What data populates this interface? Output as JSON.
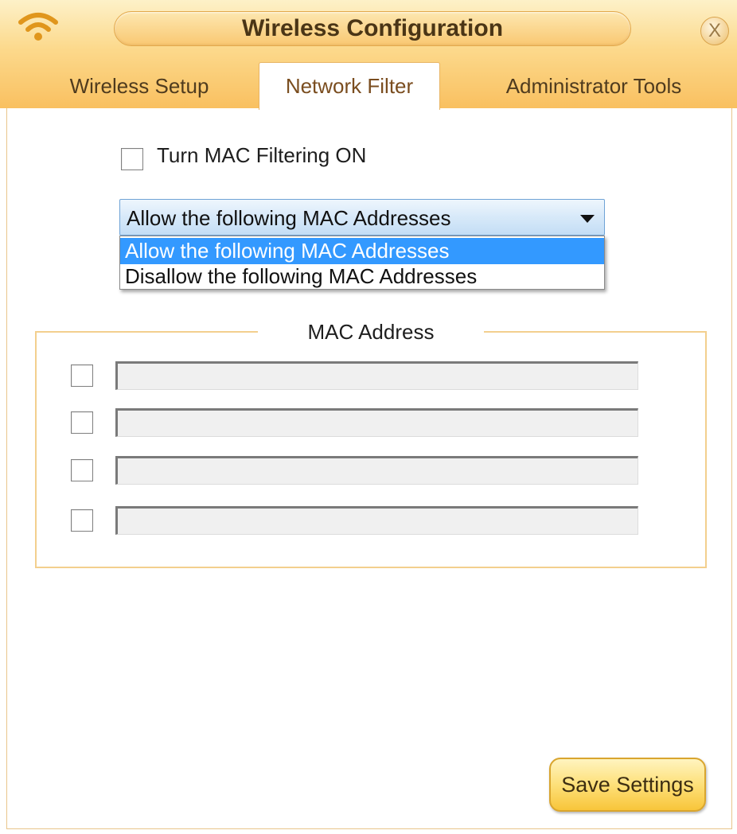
{
  "window": {
    "title": "Wireless Configuration",
    "close_glyph": "X",
    "header_icon": "wifi-icon"
  },
  "tabs": [
    {
      "label": "Wireless Setup",
      "active": false
    },
    {
      "label": "Network Filter",
      "active": true
    },
    {
      "label": "Administrator Tools",
      "active": false
    }
  ],
  "network_filter": {
    "mac_filtering_label": "Turn MAC Filtering ON",
    "mac_filtering_checked": false,
    "mode_select": {
      "selected": "Allow the following MAC Addresses",
      "expanded": true,
      "options": [
        {
          "label": "Allow the following MAC Addresses",
          "highlighted": true
        },
        {
          "label": "Disallow the following MAC Addresses",
          "highlighted": false
        }
      ]
    },
    "mac_section": {
      "legend": "MAC Address",
      "entries": [
        {
          "checked": false,
          "value": ""
        },
        {
          "checked": false,
          "value": ""
        },
        {
          "checked": false,
          "value": ""
        },
        {
          "checked": false,
          "value": ""
        }
      ]
    },
    "save_label": "Save Settings"
  },
  "colors": {
    "header_gradient_top": "#fdf1c8",
    "header_gradient_bottom": "#f9c060",
    "wifi_icon": "#e0961c",
    "select_highlight": "#3399ff",
    "fieldset_border": "#f3cf8e",
    "button_gradient_bottom": "#f8c53a"
  }
}
